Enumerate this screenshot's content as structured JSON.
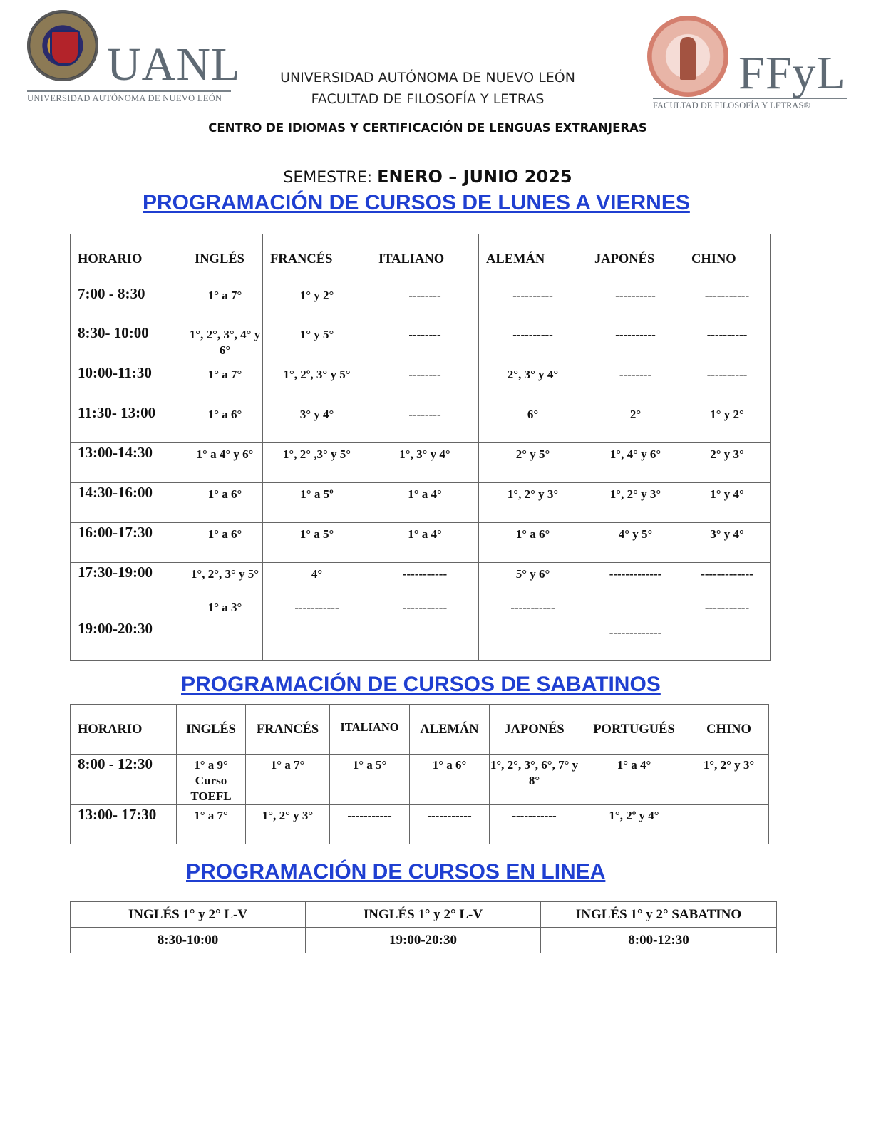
{
  "logos": {
    "uanl_word": "UANL",
    "uanl_sub": "UNIVERSIDAD AUTÓNOMA DE NUEVO LEÓN",
    "ffyl_word": "FFyL",
    "ffyl_sub": "FACULTAD DE FILOSOFÍA Y LETRAS®"
  },
  "header": {
    "university": "UNIVERSIDAD AUTÓNOMA DE NUEVO LEÓN",
    "faculty": "FACULTAD DE FILOSOFÍA Y LETRAS",
    "center": "CENTRO DE IDIOMAS Y CERTIFICACIÓN DE LENGUAS EXTRANJERAS",
    "semester_label": "SEMESTRE: ",
    "semester_value": "ENERO – JUNIO 2025"
  },
  "weekday": {
    "title": "PROGRAMACIÓN DE CURSOS DE LUNES A VIERNES",
    "headers": [
      "HORARIO",
      "INGLÉS",
      "FRANCÉS",
      "ITALIANO",
      "ALEMÁN",
      "JAPONÉS",
      "CHINO"
    ],
    "rows": [
      [
        "7:00 - 8:30",
        "1° a 7°",
        "1° y 2°",
        "--------",
        "----------",
        "----------",
        "-----------"
      ],
      [
        "8:30- 10:00",
        "1°, 2°, 3°, 4° y 6°",
        "1° y 5°",
        "--------",
        "----------",
        "----------",
        "----------"
      ],
      [
        "10:00-11:30",
        "1° a 7°",
        "1°, 2º, 3° y 5°",
        "--------",
        "2°,  3° y 4°",
        "--------",
        "----------"
      ],
      [
        "11:30- 13:00",
        "1° a 6°",
        "3° y 4°",
        "--------",
        "6°",
        "2°",
        "1° y 2°"
      ],
      [
        "13:00-14:30",
        "1° a 4° y 6°",
        "1°, 2° ,3° y 5°",
        "1°, 3° y 4°",
        "2° y 5°",
        "1°, 4° y 6°",
        "2° y 3°"
      ],
      [
        "14:30-16:00",
        "1° a 6°",
        "1° a 5º",
        "1° a 4°",
        "1°, 2° y 3°",
        "1°, 2° y 3°",
        "1° y 4°"
      ],
      [
        "16:00-17:30",
        "1° a 6°",
        "1° a 5°",
        "1° a 4°",
        "1° a 6°",
        "4° y 5°",
        "3° y 4°"
      ],
      [
        "17:30-19:00",
        "1°, 2°, 3° y 5°",
        "4°",
        "-----------",
        "5° y 6°",
        "-------------",
        "-------------"
      ],
      [
        "19:00-20:30",
        "1° a 3°",
        "-----------",
        "-----------",
        "-----------",
        "-------------",
        "-----------"
      ]
    ]
  },
  "saturday": {
    "title": "PROGRAMACIÓN DE CURSOS DE SABATINOS",
    "headers": [
      "HORARIO",
      "INGLÉS",
      "FRANCÉS",
      "ITALIANO",
      "ALEMÁN",
      "JAPONÉS",
      "PORTUGUÉS",
      "CHINO"
    ],
    "rows": [
      [
        "8:00 - 12:30",
        "1° a 9° Curso TOEFL",
        "1° a 7°",
        "1° a 5°",
        "1° a 6°",
        "1°, 2°, 3°, 6°, 7° y 8°",
        "1° a 4°",
        "1°, 2° y 3°"
      ],
      [
        "13:00- 17:30",
        "1° a 7°",
        "1°, 2° y 3°",
        "-----------",
        "-----------",
        "-----------",
        "1°, 2º y 4°",
        ""
      ]
    ]
  },
  "online": {
    "title": "PROGRAMACIÓN DE CURSOS EN LINEA",
    "headers": [
      "INGLÉS 1° y 2° L-V",
      "INGLÉS 1° y 2° L-V",
      "INGLÉS 1° y 2° SABATINO"
    ],
    "times": [
      "8:30-10:00",
      "19:00-20:30",
      "8:00-12:30"
    ]
  }
}
